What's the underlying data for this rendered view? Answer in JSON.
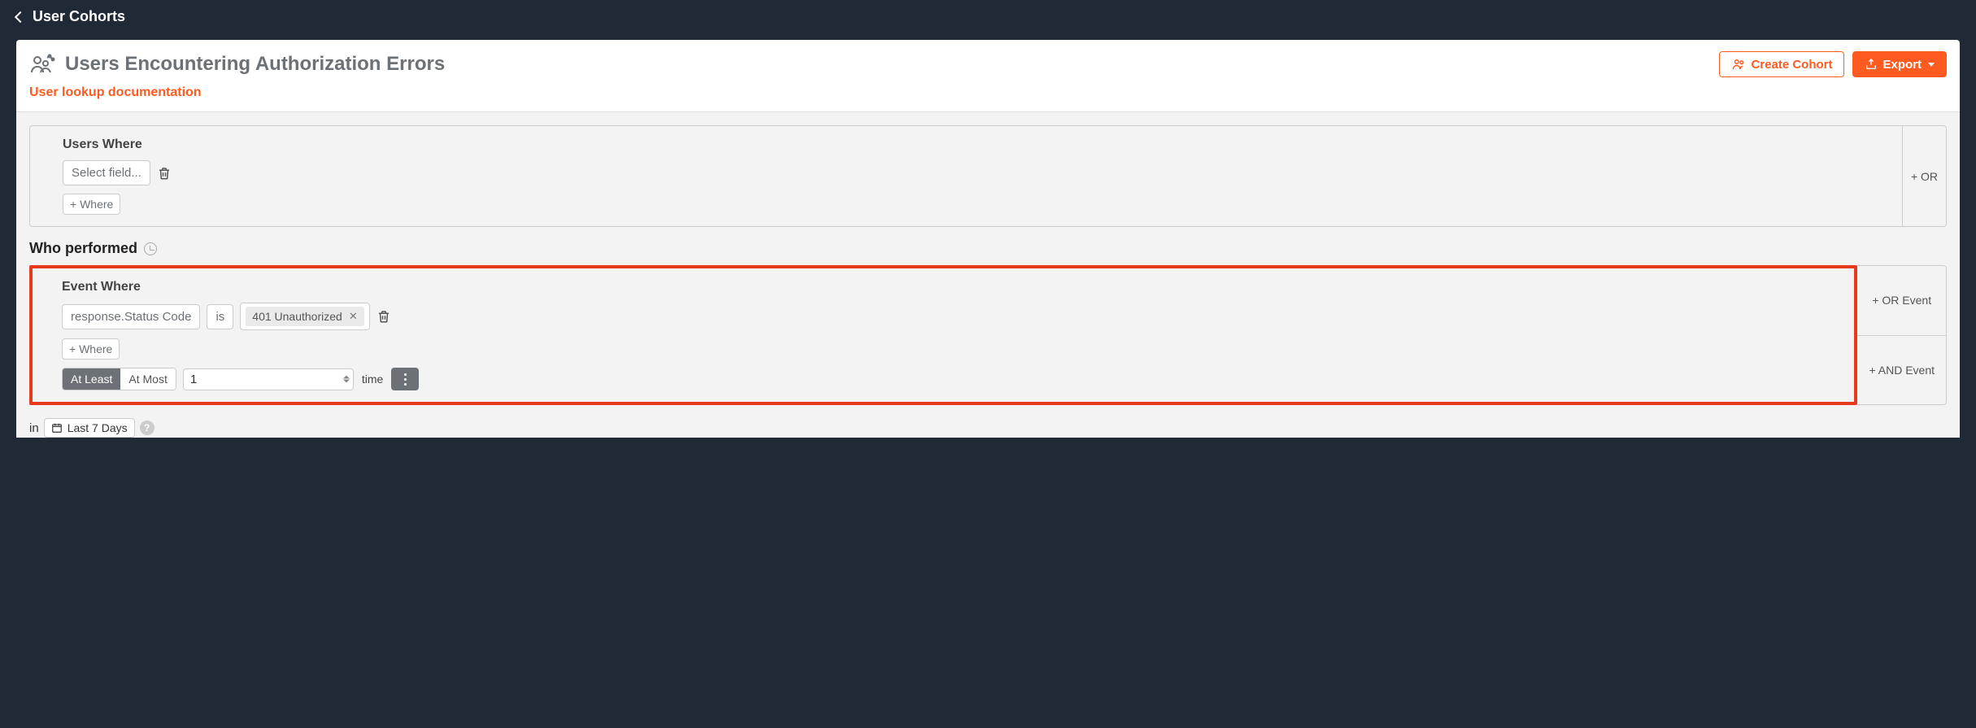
{
  "topbar": {
    "breadcrumb": "User Cohorts"
  },
  "header": {
    "title": "Users Encountering Authorization Errors",
    "create_cohort": "Create Cohort",
    "export": "Export"
  },
  "doc_link": "User lookup documentation",
  "users_where": {
    "label": "Users Where",
    "select_placeholder": "Select field...",
    "add_where": "+ Where",
    "or_label": "+ OR"
  },
  "who_performed": {
    "label": "Who performed"
  },
  "event_where": {
    "label": "Event Where",
    "field": "response.Status Code",
    "operator": "is",
    "value": "401 Unauthorized",
    "add_where": "+ Where",
    "toggle": {
      "at_least": "At Least",
      "at_most": "At Most",
      "active": "at_least"
    },
    "count": "1",
    "time_label": "time",
    "or_event": "+ OR Event",
    "and_event": "+ AND Event"
  },
  "footer": {
    "in_label": "in",
    "range": "Last 7 Days"
  }
}
